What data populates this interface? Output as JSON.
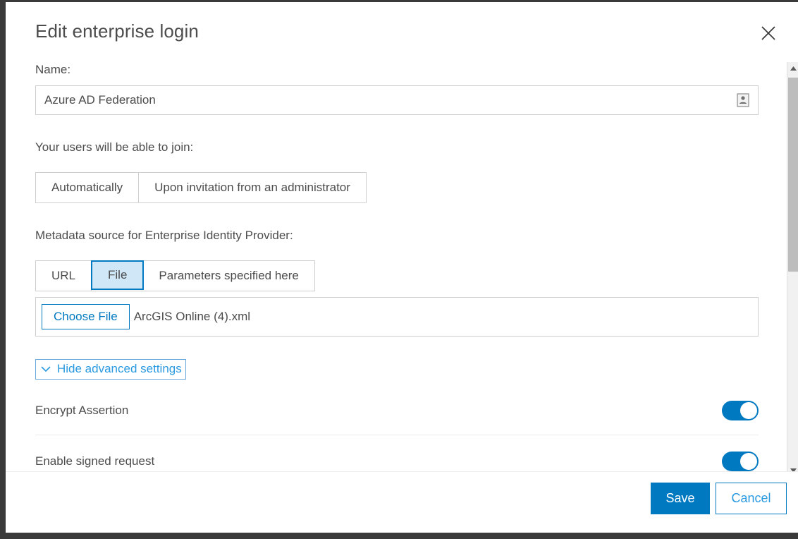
{
  "dialog": {
    "title": "Edit enterprise login",
    "close_label": "×",
    "close_icon": "close-icon"
  },
  "form": {
    "name_label": "Name:",
    "name_value": "Azure AD Federation",
    "name_placeholder": "",
    "name_field_icon": "autofill-card-icon",
    "join_label": "Your users will be able to join:",
    "join_options": [
      {
        "label": "Automatically",
        "selected": false
      },
      {
        "label": "Upon invitation from an administrator",
        "selected": false
      }
    ],
    "metadata_label": "Metadata source for Enterprise Identity Provider:",
    "metadata_options": [
      {
        "label": "URL",
        "selected": false
      },
      {
        "label": "File",
        "selected": true
      },
      {
        "label": "Parameters specified here",
        "selected": false
      }
    ],
    "choose_file_label": "Choose File",
    "chosen_file_name": "ArcGIS Online (4).xml",
    "advanced_toggle_label": "Hide advanced settings",
    "advanced_toggle_icon": "chevron-down-icon",
    "advanced_settings": [
      {
        "label": "Encrypt Assertion",
        "enabled": true
      },
      {
        "label": "Enable signed request",
        "enabled": true
      }
    ]
  },
  "footer": {
    "save_label": "Save",
    "cancel_label": "Cancel"
  },
  "scrollbar": {
    "up_icon": "triangle-up-icon",
    "down_icon": "triangle-down-icon"
  },
  "colors": {
    "accent": "#0079c1",
    "accent_light": "#2a9ae0",
    "selected_tab_bg": "#cfe7f7",
    "text": "#4c4c4c",
    "border": "#cfcfcf",
    "window_chrome": "#3a3a3a"
  }
}
